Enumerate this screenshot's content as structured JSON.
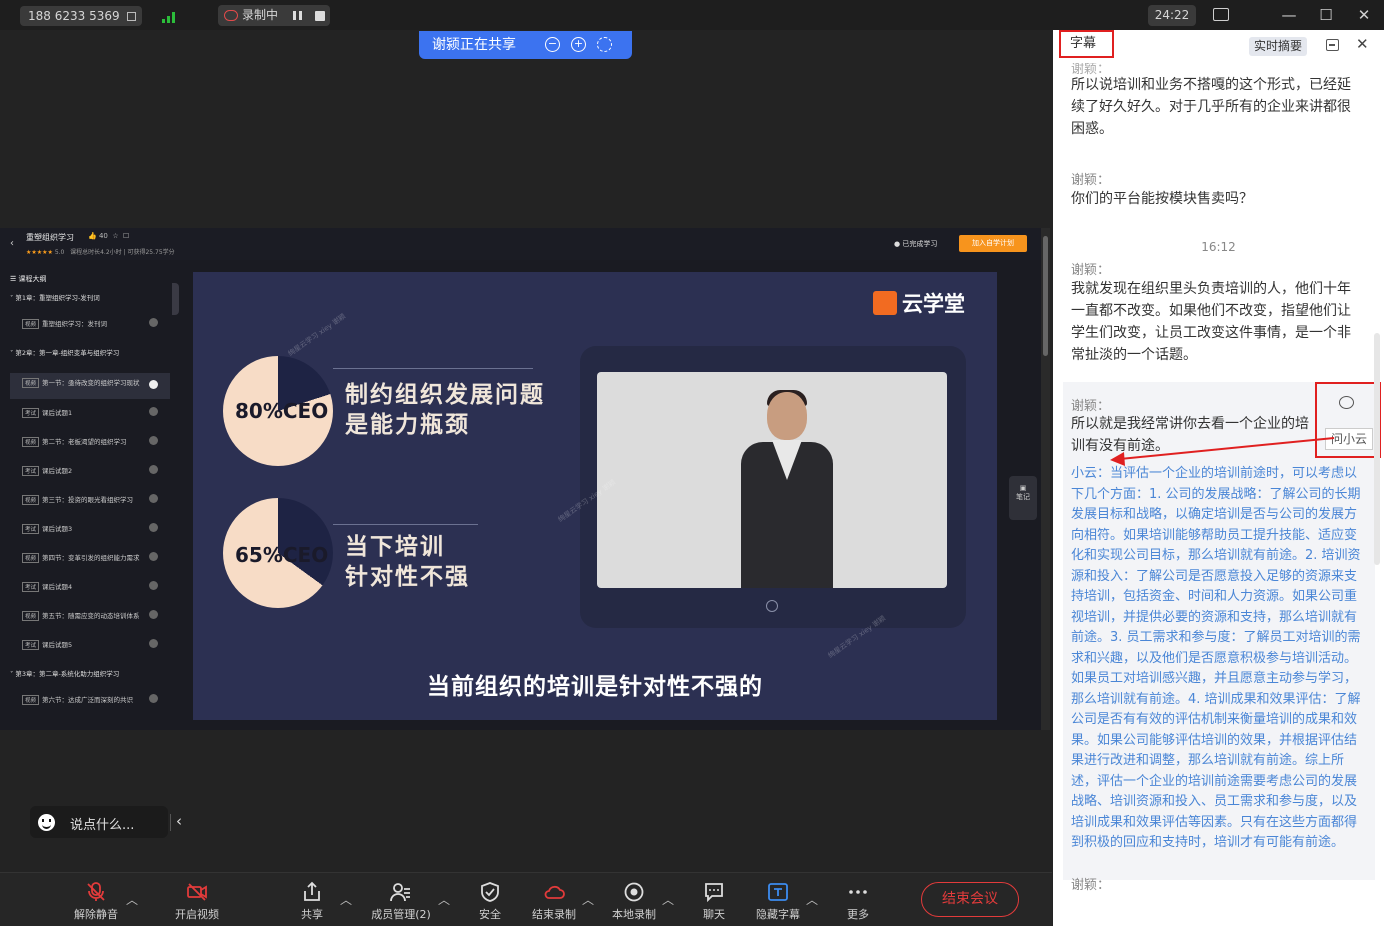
{
  "topbar": {
    "meeting_number": "188 6233 5369",
    "recording_label": "录制中",
    "timer": "24:22"
  },
  "share_banner": {
    "text": "谢颍正在共享"
  },
  "course": {
    "title": "重塑组织学习",
    "likes": "40",
    "rating_stars": "★★★★★",
    "rating": "5.0",
    "meta": "课程总时长4.2小时 | 可获得25.75学分",
    "completed_label": "已完成学习",
    "join_plan_label": "加入自学计划",
    "outline_title": "课程大纲",
    "outline": [
      {
        "type": "chapter",
        "text": "第1章：重塑组织学习-发刊词"
      },
      {
        "type": "item",
        "tag": "视频",
        "text": "重塑组织学习：发刊词"
      },
      {
        "type": "chapter",
        "text": "第2章：第一章-组织变革与组织学习"
      },
      {
        "type": "item",
        "tag": "视频",
        "text": "第一节：亟待改变的组织学习现状",
        "active": true
      },
      {
        "type": "item",
        "tag": "考试",
        "text": "课后试题1"
      },
      {
        "type": "item",
        "tag": "视频",
        "text": "第二节：老板渴望的组织学习"
      },
      {
        "type": "item",
        "tag": "考试",
        "text": "课后试题2"
      },
      {
        "type": "item",
        "tag": "视频",
        "text": "第三节：投资的眼光看组织学习"
      },
      {
        "type": "item",
        "tag": "考试",
        "text": "课后试题3"
      },
      {
        "type": "item",
        "tag": "视频",
        "text": "第四节：变革引发的组织能力需求"
      },
      {
        "type": "item",
        "tag": "考试",
        "text": "课后试题4"
      },
      {
        "type": "item",
        "tag": "视频",
        "text": "第五节：随需应变的动态培训体系"
      },
      {
        "type": "item",
        "tag": "考试",
        "text": "课后试题5"
      },
      {
        "type": "chapter",
        "text": "第3章：第二章-系统化助力组织学习"
      },
      {
        "type": "item",
        "tag": "视频",
        "text": "第六节：达成广泛而深刻的共识"
      }
    ],
    "notes_label": "笔记"
  },
  "slide": {
    "logo_text": "云学堂",
    "stat1_label": "80%CEO",
    "stat1_fraction": 0.8,
    "stat1_text_line1": "制约组织发展问题",
    "stat1_text_line2": "是能力瓶颈",
    "stat2_label": "65%CEO",
    "stat2_fraction": 0.65,
    "stat2_text_line1": "当下培训",
    "stat2_text_line2": "针对性不强",
    "subtitle": "当前组织的培训是针对性不强的",
    "watermark": "绚星云学习 xiey 谢颖"
  },
  "chat_input": {
    "placeholder": "说点什么..."
  },
  "toolbar": {
    "items": [
      {
        "label": "解除静音"
      },
      {
        "label": "开启视频"
      },
      {
        "label": "共享"
      },
      {
        "label": "成员管理(2)"
      },
      {
        "label": "安全"
      },
      {
        "label": "结束录制"
      },
      {
        "label": "本地录制"
      },
      {
        "label": "聊天"
      },
      {
        "label": "隐藏字幕"
      },
      {
        "label": "更多"
      }
    ],
    "end_meeting": "结束会议"
  },
  "panel": {
    "tab_subtitle": "字幕",
    "tab_summary": "实时摘要",
    "messages": [
      {
        "speaker": "谢颖：",
        "text": "所以说培训和业务不搭嘎的这个形式，已经延续了好久好久。对于几乎所有的企业来讲都很困惑。"
      },
      {
        "speaker": "谢颖：",
        "text": "你们的平台能按模块售卖吗？"
      },
      {
        "time": "16:12"
      },
      {
        "speaker": "谢颖：",
        "text": "我就发现在组织里头负责培训的人，他们十年一直都不改变。如果他们不改变，指望他们让学生们改变，让员工改变这件事情，是一个非常扯淡的一个话题。"
      },
      {
        "speaker": "谢颖：",
        "text": "所以就是我经常讲你去看一个企业的培训有没有前途。"
      },
      {
        "speaker": "谢颖："
      }
    ],
    "ask_tooltip": "问小云",
    "ai_answer": "小云：当评估一个企业的培训前途时，可以考虑以下几个方面：1. 公司的发展战略：了解公司的长期发展目标和战略，以确定培训是否与公司的发展方向相符。如果培训能够帮助员工提升技能、适应变化和实现公司目标，那么培训就有前途。2. 培训资源和投入：了解公司是否愿意投入足够的资源来支持培训，包括资金、时间和人力资源。如果公司重视培训，并提供必要的资源和支持，那么培训就有前途。3. 员工需求和参与度：了解员工对培训的需求和兴趣，以及他们是否愿意积极参与培训活动。如果员工对培训感兴趣，并且愿意主动参与学习，那么培训就有前途。4. 培训成果和效果评估：了解公司是否有有效的评估机制来衡量培训的成果和效果。如果公司能够评估培训的效果，并根据评估结果进行改进和调整，那么培训就有前途。综上所述，评估一个企业的培训前途需要考虑公司的发展战略、培训资源和投入、员工需求和参与度，以及培训成果和效果评估等因素。只有在这些方面都得到积极的回应和支持时，培训才有可能有前途。"
  },
  "colors": {
    "accent_blue": "#3c73f0",
    "danger_red": "#e23b3b",
    "ai_text_blue": "#4a86d6",
    "signal_green": "#2bbd3a",
    "logo_orange": "#f26b21"
  }
}
